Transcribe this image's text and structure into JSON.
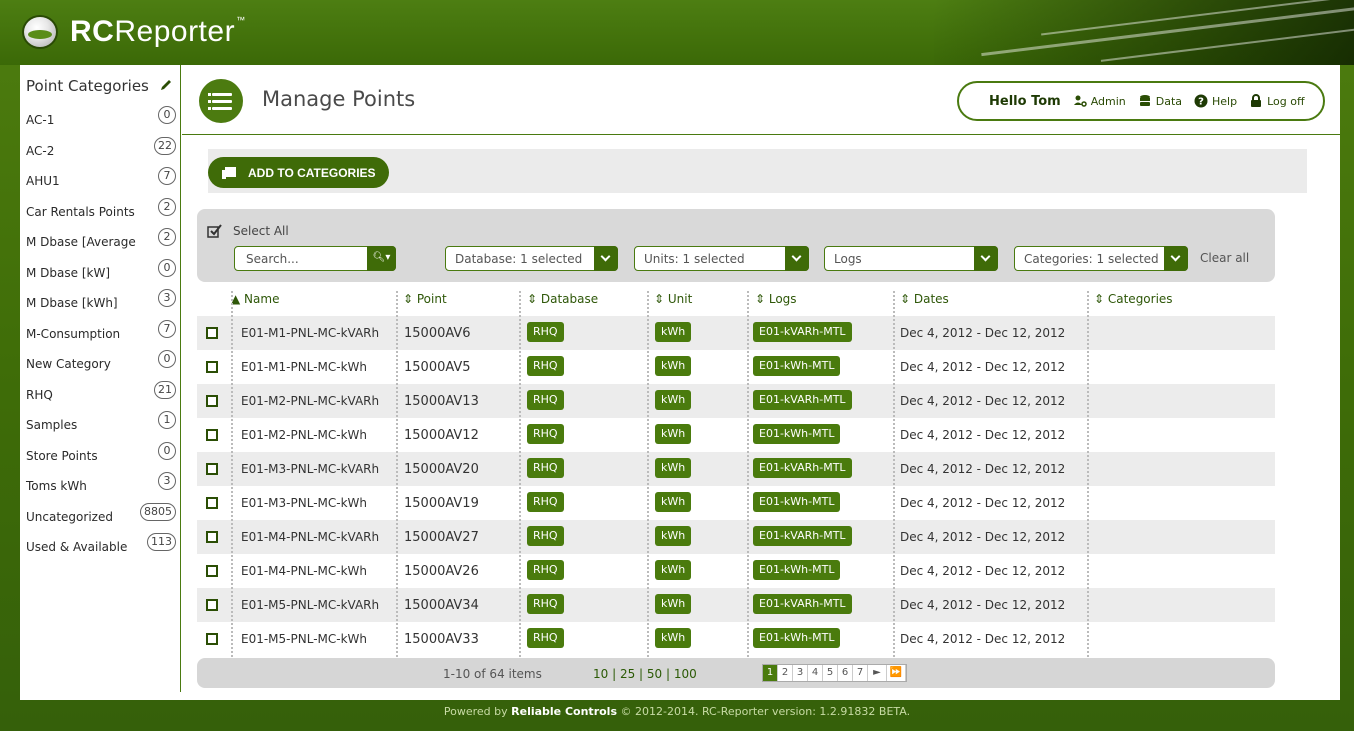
{
  "brand": {
    "bold": "RC",
    "rest": "Reporter",
    "tm": "™"
  },
  "sidebar": {
    "title": "Point Categories",
    "items": [
      {
        "label": "AC-1",
        "count": "0"
      },
      {
        "label": "AC-2",
        "count": "22"
      },
      {
        "label": "AHU1",
        "count": "7"
      },
      {
        "label": "Car Rentals Points",
        "count": "2"
      },
      {
        "label": "M Dbase [Average",
        "count": "2"
      },
      {
        "label": "M Dbase [kW]",
        "count": "0"
      },
      {
        "label": "M Dbase [kWh]",
        "count": "3"
      },
      {
        "label": "M-Consumption",
        "count": "7"
      },
      {
        "label": "New Category",
        "count": "0"
      },
      {
        "label": "RHQ",
        "count": "21"
      },
      {
        "label": "Samples",
        "count": "1"
      },
      {
        "label": "Store Points",
        "count": "0"
      },
      {
        "label": "Toms kWh",
        "count": "3"
      },
      {
        "label": "Uncategorized",
        "count": "8805"
      },
      {
        "label": "Used & Available",
        "count": "113"
      }
    ]
  },
  "header": {
    "title": "Manage Points",
    "hello": "Hello Tom",
    "links": {
      "admin": "Admin",
      "data": "Data",
      "help": "Help",
      "logoff": "Log off"
    }
  },
  "toolbar": {
    "add_label": "ADD TO CATEGORIES"
  },
  "filters": {
    "select_all": "Select All",
    "search_placeholder": "Search...",
    "database": "Database: 1 selected",
    "units": "Units: 1 selected",
    "logs": "Logs",
    "categories": "Categories: 1 selected",
    "clear_all": "Clear all"
  },
  "table": {
    "columns": [
      "▲ Name",
      "⇕ Point",
      "⇕ Database",
      "⇕ Unit",
      "⇕ Logs",
      "⇕ Dates",
      "⇕ Categories"
    ],
    "rows": [
      {
        "name": "E01-M1-PNL-MC-kVARh",
        "point": "15000AV6",
        "db": "RHQ",
        "unit": "kWh",
        "log": "E01-kVARh-MTL",
        "dates": "Dec 4, 2012 - Dec 12, 2012"
      },
      {
        "name": "E01-M1-PNL-MC-kWh",
        "point": "15000AV5",
        "db": "RHQ",
        "unit": "kWh",
        "log": "E01-kWh-MTL",
        "dates": "Dec 4, 2012 - Dec 12, 2012"
      },
      {
        "name": "E01-M2-PNL-MC-kVARh",
        "point": "15000AV13",
        "db": "RHQ",
        "unit": "kWh",
        "log": "E01-kVARh-MTL",
        "dates": "Dec 4, 2012 - Dec 12, 2012"
      },
      {
        "name": "E01-M2-PNL-MC-kWh",
        "point": "15000AV12",
        "db": "RHQ",
        "unit": "kWh",
        "log": "E01-kWh-MTL",
        "dates": "Dec 4, 2012 - Dec 12, 2012"
      },
      {
        "name": "E01-M3-PNL-MC-kVARh",
        "point": "15000AV20",
        "db": "RHQ",
        "unit": "kWh",
        "log": "E01-kVARh-MTL",
        "dates": "Dec 4, 2012 - Dec 12, 2012"
      },
      {
        "name": "E01-M3-PNL-MC-kWh",
        "point": "15000AV19",
        "db": "RHQ",
        "unit": "kWh",
        "log": "E01-kWh-MTL",
        "dates": "Dec 4, 2012 - Dec 12, 2012"
      },
      {
        "name": "E01-M4-PNL-MC-kVARh",
        "point": "15000AV27",
        "db": "RHQ",
        "unit": "kWh",
        "log": "E01-kVARh-MTL",
        "dates": "Dec 4, 2012 - Dec 12, 2012"
      },
      {
        "name": "E01-M4-PNL-MC-kWh",
        "point": "15000AV26",
        "db": "RHQ",
        "unit": "kWh",
        "log": "E01-kWh-MTL",
        "dates": "Dec 4, 2012 - Dec 12, 2012"
      },
      {
        "name": "E01-M5-PNL-MC-kVARh",
        "point": "15000AV34",
        "db": "RHQ",
        "unit": "kWh",
        "log": "E01-kVARh-MTL",
        "dates": "Dec 4, 2012 - Dec 12, 2012"
      },
      {
        "name": "E01-M5-PNL-MC-kWh",
        "point": "15000AV33",
        "db": "RHQ",
        "unit": "kWh",
        "log": "E01-kWh-MTL",
        "dates": "Dec 4, 2012 - Dec 12, 2012"
      }
    ]
  },
  "pager": {
    "info": "1-10 of 64 items",
    "sizes": "10 | 25 | 50 | 100",
    "pages": [
      "1",
      "2",
      "3",
      "4",
      "5",
      "6",
      "7"
    ],
    "next": "►",
    "last": "⏩"
  },
  "footer": {
    "prefix": "Powered by ",
    "company": "Reliable Controls",
    "suffix": " © 2012-2014. RC-Reporter version: 1.2.91832 BETA."
  },
  "colors": {
    "brand_green": "#3f6b08",
    "pill_green": "#4a7b0d",
    "banner": "#4d7e12"
  },
  "icons": {
    "pencil": "pencil-icon",
    "menu": "list-icon",
    "admin": "users-gear-icon",
    "data": "database-icon",
    "help": "help-icon",
    "logoff": "lock-icon"
  }
}
